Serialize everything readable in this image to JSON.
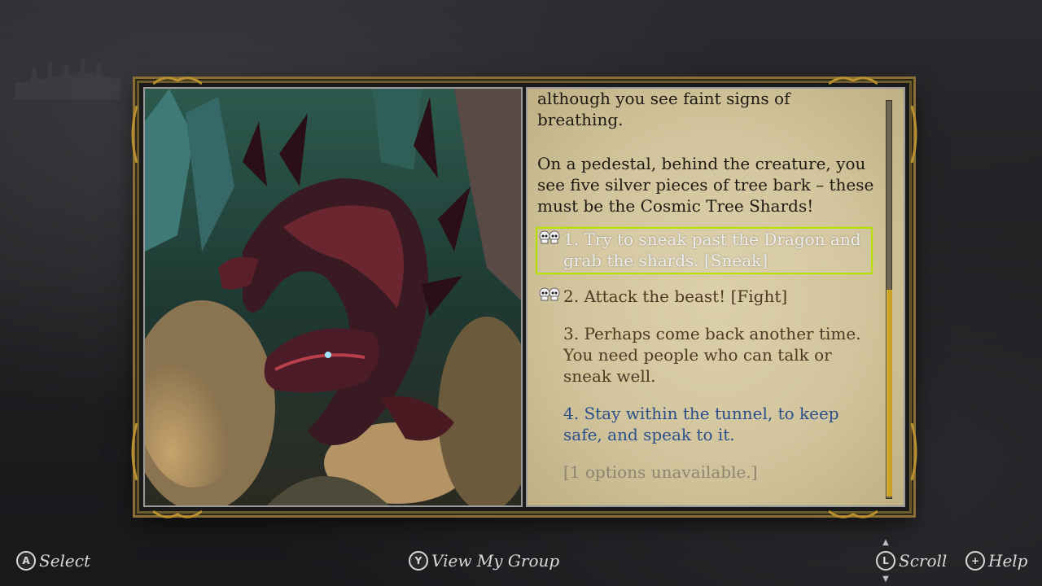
{
  "story": {
    "text_top": "although you see faint signs of breathing.",
    "text_mid": "On a pedestal, behind the creature, you see five silver pieces of tree bark – these must be the Cosmic Tree Shards!",
    "options": [
      {
        "text": "1. Try to sneak past the Dragon and grab the shards.  [Sneak]",
        "icon": "skull-pair-icon",
        "state": "selected",
        "color": "#eeeeee"
      },
      {
        "text": "2. Attack the beast!  [Fight]",
        "icon": "skull-pair-icon",
        "state": "risky",
        "color": "#4b3b23"
      },
      {
        "text": "3. Perhaps come back another time. You need people who can talk or sneak well.",
        "icon": "",
        "state": "normal",
        "color": "#4b3b23"
      },
      {
        "text": "4. Stay within the tunnel, to keep safe, and speak to it.",
        "icon": "",
        "state": "special",
        "color": "#2a4f8d"
      },
      {
        "text": "[1 options unavailable.]",
        "icon": "",
        "state": "unavailable",
        "color": "#8d8570"
      }
    ],
    "highlight_color": "#b7e000"
  },
  "illustration": {
    "subject": "dragon-illustration"
  },
  "controls": {
    "select": {
      "button": "A",
      "label": "Select"
    },
    "group": {
      "button": "Y",
      "label": "View My Group"
    },
    "scroll": {
      "button": "L",
      "label": "Scroll"
    },
    "help": {
      "button": "+",
      "label": "Help"
    }
  }
}
